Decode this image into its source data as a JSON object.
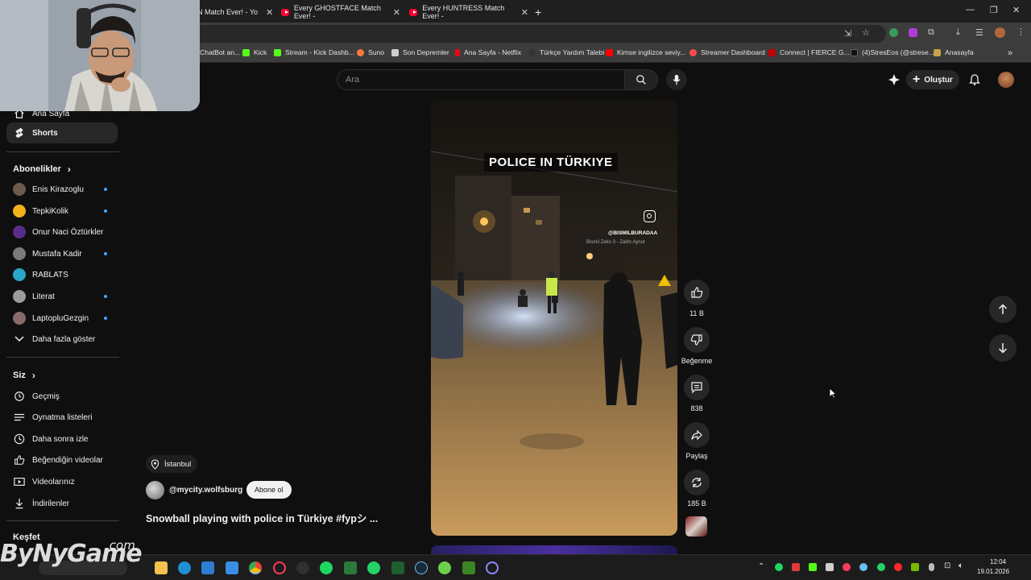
{
  "browser": {
    "tabs": [
      {
        "label": "N Match Ever! - Yo"
      },
      {
        "label": "Every GHOSTFACE Match Ever! -"
      },
      {
        "label": "Every HUNTRESS Match Ever! -"
      }
    ],
    "new_tab_icon": "plus-icon",
    "bookmarks": [
      {
        "label": "ChatBot an...",
        "color": "#9aa0a6"
      },
      {
        "label": "Kick",
        "color": "#53fc18"
      },
      {
        "label": "Stream - Kick Dashb...",
        "color": "#53fc18"
      },
      {
        "label": "Suno",
        "color": "#ff7a3d"
      },
      {
        "label": "Son Depremler",
        "color": "#cfcfcf"
      },
      {
        "label": "Ana Sayfa - Netflix",
        "color": "#e50914"
      },
      {
        "label": "Türkçe Yardım Talebi",
        "color": "#333333"
      },
      {
        "label": "Kimse ingilizce seviy...",
        "color": "#ff0000"
      },
      {
        "label": "Streamer Dashboard",
        "color": "#ff4b4b"
      },
      {
        "label": "Connect | FIERCE G...",
        "color": "#c00000"
      },
      {
        "label": "(4)StresEos (@strese...",
        "color": "#111111"
      },
      {
        "label": "Anasayfa",
        "color": "#c8a24a"
      }
    ]
  },
  "header": {
    "search_placeholder": "Ara",
    "create_label": "Oluştur"
  },
  "sidebar": {
    "home_label": "Ana Sayfa",
    "shorts_label": "Shorts",
    "subscriptions_heading": "Abonelikler",
    "subscriptions": [
      {
        "label": "Enis Kirazoglu",
        "color": "#6b5a4e",
        "live": true
      },
      {
        "label": "TepkiKolik",
        "color": "#f2b21b",
        "live": true
      },
      {
        "label": "Onur Naci Öztürkler",
        "color": "#5b2d8a",
        "live": false
      },
      {
        "label": "Mustafa Kadir",
        "color": "#7a7a7a",
        "live": true
      },
      {
        "label": "RABLATS",
        "color": "#2aa6c8",
        "live": false
      },
      {
        "label": "Literat",
        "color": "#9a9a9a",
        "live": true
      },
      {
        "label": "LaptopluGezgin",
        "color": "#8a6b6b",
        "live": true
      }
    ],
    "show_more_label": "Daha fazla göster",
    "you_heading": "Siz",
    "you_items": [
      {
        "label": "Geçmiş",
        "icon": "history-icon"
      },
      {
        "label": "Oynatma listeleri",
        "icon": "playlist-icon"
      },
      {
        "label": "Daha sonra izle",
        "icon": "clock-icon"
      },
      {
        "label": "Beğendiğin videolar",
        "icon": "like-icon"
      },
      {
        "label": "Videolarınız",
        "icon": "video-icon"
      },
      {
        "label": "İndirilenler",
        "icon": "download-icon"
      }
    ],
    "explore_heading": "Keşfet"
  },
  "short": {
    "overlay_title": "POLICE IN TÜRKIYE",
    "ig_handle": "@BISMILBURADAA",
    "ig_song": "Bismil Zeko 3 - Zalim Aynur",
    "location": "İstanbul",
    "channel": "@mycity.wolfsburg",
    "subscribe_label": "Abone ol",
    "title": "Snowball playing with police in Türkiye #fypシ ..."
  },
  "actions": {
    "like_count": "11 B",
    "dislike_label": "Beğenme",
    "comment_count": "838",
    "share_label": "Paylaş",
    "remix_count": "185 B"
  },
  "taskbar": {
    "time": "12:04",
    "date": "19.01.2026"
  },
  "watermark": {
    "main": "ByNyGame",
    "sub": ".com"
  },
  "colors": {
    "page_bg": "#0f0f0f",
    "accent_blue": "#3ea6ff",
    "youtube_red": "#ff0033"
  }
}
